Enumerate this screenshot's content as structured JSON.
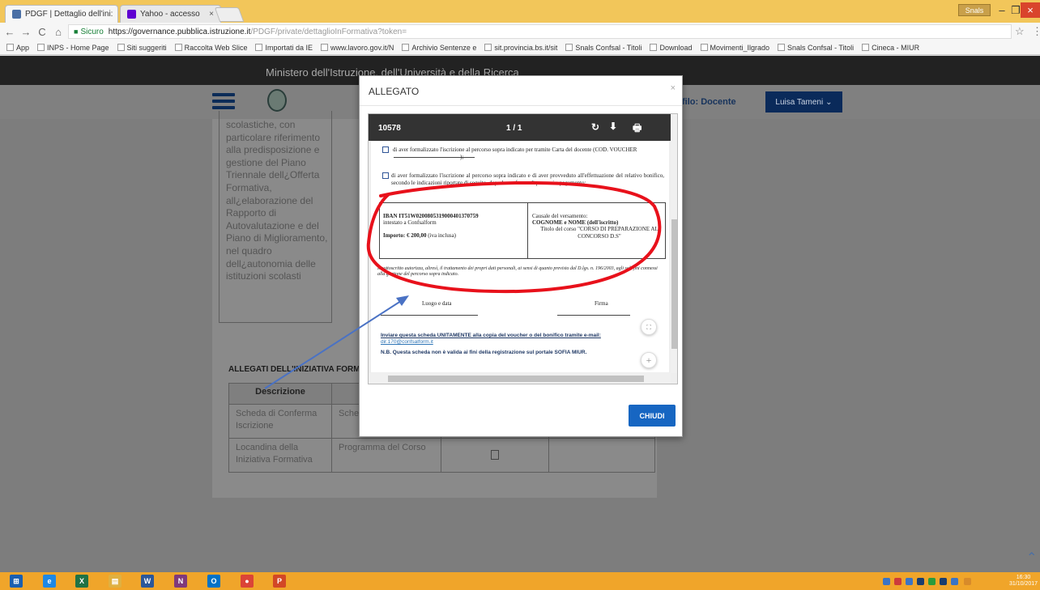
{
  "browser": {
    "tabs": [
      {
        "label": "PDGF | Dettaglio dell'ini:",
        "close": "×",
        "favicon_color": "#4a6fa5"
      },
      {
        "label": "Yahoo - accesso",
        "close": "×",
        "favicon_color": "#5f01d1"
      }
    ],
    "user_chip": "Snals",
    "window_buttons": {
      "minimize": "–",
      "maximize": "❐",
      "close": "×"
    },
    "nav": {
      "back": "←",
      "forward": "→",
      "reload": "C",
      "home": "⌂"
    },
    "url": {
      "secure_label": "Sicuro",
      "host": "https://governance.pubblica.istruzione.it",
      "path": "/PDGF/private/dettaglioInFormativa?token="
    },
    "bookmarks": [
      "App",
      "INPS - Home Page",
      "Siti suggeriti",
      "Raccolta Web Slice",
      "Importati da IE",
      "www.lavoro.gov.it/N",
      "Archivio Sentenze e",
      "sit.provincia.bs.it/sit",
      "Snals Confsal - Titoli",
      "Download",
      "Movimenti_Ilgrado",
      "Snals Confsal - Titoli",
      "Cineca - MIUR"
    ]
  },
  "site": {
    "ministry_title": "Ministero dell'Istruzione, dell'Università e della Ricerca",
    "role_label": "filo: Docente",
    "user_button": "Luisa Tameni",
    "user_chevron": "⌄"
  },
  "content": {
    "description": "scolastiche, con particolare riferimento alla predisposizione e gestione del Piano Triennale dell¿Offerta Formativa, all¿elaborazione del Rapporto di Autovalutazione e del Piano di Miglioramento, nel quadro dell¿autonomia delle istituzioni scolasti",
    "allegati_title": "ALLEGATI DELL'INIZIATIVA FORMATIVA",
    "table": {
      "header": "Descrizione",
      "rows": [
        {
          "c1": "Scheda di Conferma Iscrizione",
          "c2": "Scheda iscrizione"
        },
        {
          "c1": "Locandina della Iniziativa Formativa",
          "c2": "Programma del Corso"
        }
      ]
    }
  },
  "modal": {
    "title": "ALLEGATO",
    "close": "×",
    "viewer": {
      "doc_number": "10578",
      "page_indicator": "1 / 1",
      "rotate_icon": "↻",
      "download_icon": "⬇",
      "print_icon": "🖶"
    },
    "document": {
      "option1": "di aver formalizzato l'iscrizione al percorso sopra indicato per tramite Carta del docente (COD. VOUCHER",
      "option1_end": ");",
      "option2": "di aver formalizzato l'iscrizione al percorso sopra indicato e di aver provveduto all'effettuazione del relativo bonifico, secondo le indicazioni riportate di seguito, dopo la conferma di percorsi a pagamento:",
      "iban": "IBAN IT51W0200805319000401370759",
      "iban_sub": "intestato a Confsalform",
      "importo": "Importo: € 200,00",
      "importo_note": " (iva inclusa)",
      "causale_label": "Causale del versamento:",
      "causale_name": "COGNOME e NOME (dell'iscritto)",
      "causale_title": "Titolo del corso \"CORSO DI PREPARAZIONE AL CONCORSO D.S\"",
      "privacy": "Il sottoscritto autorizza, altresì, il trattamento dei propri dati personali, ai sensi di quanto previsto dal D.lgs. n. 196/2003, agli soli fini connessi alla gestione del percorso sopra indicato.",
      "luogo": "Luogo e data",
      "firma": "Firma",
      "send_note": "Inviare questa scheda UNITAMENTE alla copia del voucher o del bonifico tramite e-mail:",
      "send_email": "dir.170@confsalform.it",
      "nb_note": "N.B. Questa scheda non è valida ai fini della registrazione sul portale SOFIA MIUR."
    },
    "zoom": {
      "fit": "⛶",
      "in": "+",
      "out": "−"
    },
    "close_button": "CHIUDI"
  },
  "taskbar": {
    "apps": [
      {
        "name": "start",
        "glyph": "⊞",
        "color": "#1b5fb0"
      },
      {
        "name": "internet-explorer",
        "glyph": "e",
        "color": "#1e88e5"
      },
      {
        "name": "excel",
        "glyph": "X",
        "color": "#207245"
      },
      {
        "name": "file-explorer",
        "glyph": "▤",
        "color": "#e0b040"
      },
      {
        "name": "word",
        "glyph": "W",
        "color": "#2b579a"
      },
      {
        "name": "onenote",
        "glyph": "N",
        "color": "#80397b"
      },
      {
        "name": "outlook",
        "glyph": "O",
        "color": "#0072c6"
      },
      {
        "name": "chrome",
        "glyph": "●",
        "color": "#db4437"
      },
      {
        "name": "powerpoint",
        "glyph": "P",
        "color": "#d24726"
      }
    ],
    "time": "16:30",
    "date": "31/10/2017"
  },
  "annotation_colors": {
    "circle": "#e8111b",
    "arrow": "#4a72c4"
  }
}
